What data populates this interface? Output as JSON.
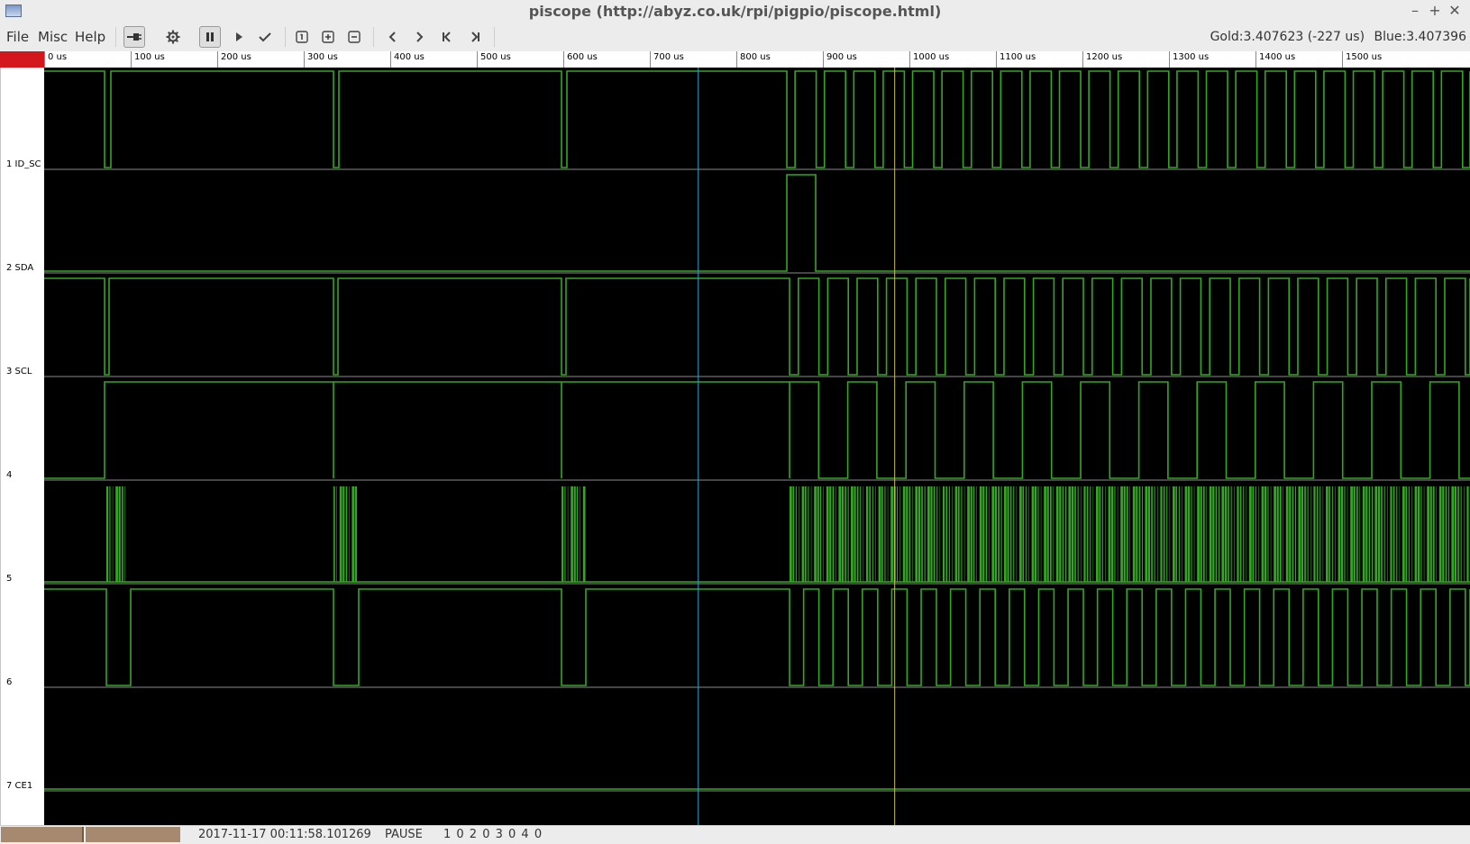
{
  "window": {
    "title": "piscope (http://abyz.co.uk/rpi/pigpio/piscope.html)",
    "controls": {
      "minimize": "–",
      "maximize": "+",
      "close": "✕"
    }
  },
  "menu": [
    {
      "label": "File"
    },
    {
      "label": "Misc"
    },
    {
      "label": "Help"
    }
  ],
  "toolbar": [
    {
      "name": "connect-icon",
      "state": "active"
    },
    {
      "name": "settings-icon"
    },
    {
      "name": "pause-icon",
      "state": "active"
    },
    {
      "name": "play-icon"
    },
    {
      "name": "check-icon"
    },
    {
      "name": "zoom-one-icon"
    },
    {
      "name": "zoom-in-icon"
    },
    {
      "name": "zoom-out-icon"
    },
    {
      "name": "chevron-left-icon"
    },
    {
      "name": "chevron-right-icon"
    },
    {
      "name": "skip-start-icon"
    },
    {
      "name": "skip-end-icon"
    }
  ],
  "readout": {
    "gold": "Gold:3.407623 (-227 us)",
    "blue": "Blue:3.407396"
  },
  "timescale": {
    "ticks": [
      "0 us",
      "100 us",
      "200 us",
      "300 us",
      "400 us",
      "500 us",
      "600 us",
      "700 us",
      "800 us",
      "900 us",
      "1000 us",
      "1100 us",
      "1200 us",
      "1300 us",
      "1400 us",
      "1500 us"
    ]
  },
  "channels": [
    {
      "label": "1 ID_SC"
    },
    {
      "label": "2 SDA"
    },
    {
      "label": "3 SCL"
    },
    {
      "label": "4"
    },
    {
      "label": "5"
    },
    {
      "label": "6"
    },
    {
      "label": "7 CE1"
    }
  ],
  "cursors": {
    "blue_us": 756,
    "gold_us": 983
  },
  "colors": {
    "trace": "#35a624",
    "baseline": "#8a8a8a",
    "blue_cursor": "#2aa3c8",
    "gold_cursor": "#c8c060",
    "background": "#000000"
  },
  "status": {
    "timestamp": "2017-11-17 00:11:58.101269",
    "mode": "PAUSE",
    "triggers": "1 0  2 0  3 0  4 0"
  }
}
